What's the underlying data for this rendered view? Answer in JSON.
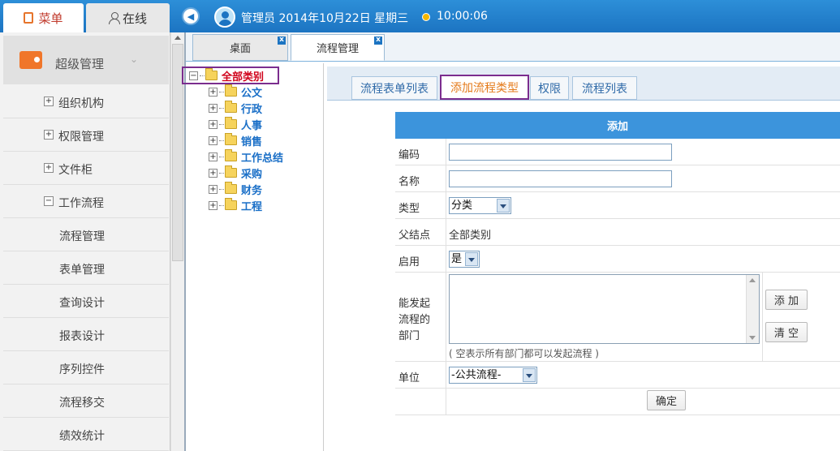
{
  "top": {
    "menu_tab": "菜单",
    "online_tab": "在线",
    "user": "管理员 2014年10月22日 星期三",
    "time": "10:00:06"
  },
  "sidebar": {
    "header": "超级管理",
    "items": [
      {
        "label": "组织机构",
        "expand": "+"
      },
      {
        "label": "权限管理",
        "expand": "+"
      },
      {
        "label": "文件柜",
        "expand": "+"
      },
      {
        "label": "工作流程",
        "expand": "−"
      }
    ],
    "subitems": [
      "流程管理",
      "表单管理",
      "查询设计",
      "报表设计",
      "序列控件",
      "流程移交",
      "绩效统计"
    ]
  },
  "page_tabs": [
    {
      "label": "桌面",
      "close": "x"
    },
    {
      "label": "流程管理",
      "close": "x"
    }
  ],
  "tree": {
    "root": "全部类别",
    "root_toggle": "−",
    "toggle": "+",
    "nodes": [
      "公文",
      "行政",
      "人事",
      "销售",
      "工作总结",
      "采购",
      "财务",
      "工程"
    ]
  },
  "content_tabs": [
    "流程表单列表",
    "添加流程类型",
    "权限",
    "流程列表"
  ],
  "form": {
    "title": "添加",
    "code_label": "编码",
    "code_value": "",
    "name_label": "名称",
    "name_value": "",
    "type_label": "类型",
    "type_value": "分类",
    "parent_label": "父结点",
    "parent_value": "全部类别",
    "enabled_label": "启用",
    "enabled_value": "是",
    "dept_label_1": "能发起",
    "dept_label_2": "流程的",
    "dept_label_3": "部门",
    "dept_hint": "( 空表示所有部门都可以发起流程 )",
    "add_button": "添 加",
    "clear_button": "清 空",
    "unit_label": "单位",
    "unit_value": "-公共流程-",
    "confirm_button": "确定"
  },
  "colors": {
    "topbar": "#1c74c2",
    "accent_orange": "#e47a1a",
    "highlight_border": "#7b2d8e",
    "tree_root": "#d0021b",
    "tree_node": "#1a6fc7",
    "form_header": "#3c94dc"
  }
}
